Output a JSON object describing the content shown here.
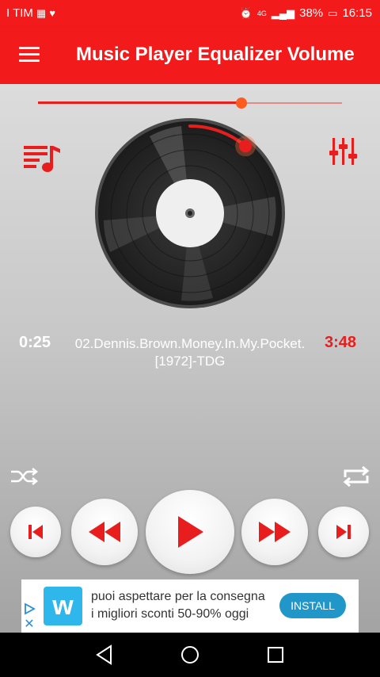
{
  "status_bar": {
    "carrier": "I TIM",
    "network": "4G",
    "battery": "38%",
    "time": "16:15"
  },
  "app_bar": {
    "title": "Music Player Equalizer Volume"
  },
  "volume": {
    "level": 0.67
  },
  "player": {
    "current_time": "0:25",
    "total_time": "3:48",
    "track_line1": "02.Dennis.Brown.Money.In.My.Pocket.",
    "track_line2": "[1972]-TDG",
    "progress": 0.11
  },
  "ad": {
    "line1": "puoi aspettare per la consegna",
    "line2": "i migliori sconti 50-90% oggi",
    "install_label": "INSTALL",
    "logo_letter": "w"
  },
  "colors": {
    "accent": "#f21a1a",
    "ad_button": "#2196c9",
    "ad_logo": "#2fb7ec"
  }
}
